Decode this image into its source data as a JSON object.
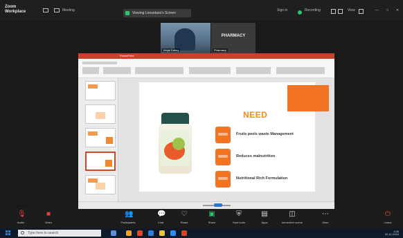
{
  "app": {
    "brand": "Zoom\nWorkplace",
    "meeting_tab": "Meeting",
    "meeting_pill": "Viewing Lonuotaos's Screen",
    "view_label": "View",
    "recording_label": "Recording"
  },
  "participants": [
    {
      "label": "Kinjal Dubey",
      "kind": "camera"
    },
    {
      "label": "Pharmacy",
      "big": "PHARMACY",
      "kind": "name"
    }
  ],
  "slide": {
    "heading": "NEED",
    "items": [
      "Fruits peels waste Management",
      "Reduces malnutrition",
      "Nutritional Rich Formulation"
    ],
    "accent": "#f27322"
  },
  "controls": [
    {
      "label": "Audio",
      "icon": "microphone-muted-icon"
    },
    {
      "label": "Video",
      "icon": "video-off-icon"
    },
    {
      "label": "Participants",
      "icon": "participants-icon"
    },
    {
      "label": "Chat",
      "icon": "chat-icon"
    },
    {
      "label": "React",
      "icon": "react-icon"
    },
    {
      "label": "Share",
      "icon": "share-icon"
    },
    {
      "label": "Host tools",
      "icon": "host-tools-icon"
    },
    {
      "label": "Apps",
      "icon": "apps-icon"
    },
    {
      "label": "Immersive scene",
      "icon": "immersive-icon"
    },
    {
      "label": "More",
      "icon": "more-icon"
    },
    {
      "label": "Leave",
      "icon": "leave-icon"
    }
  ],
  "taskbar": {
    "search_placeholder": "Type here to search",
    "time": "1:06",
    "date": "22-11-2024"
  }
}
